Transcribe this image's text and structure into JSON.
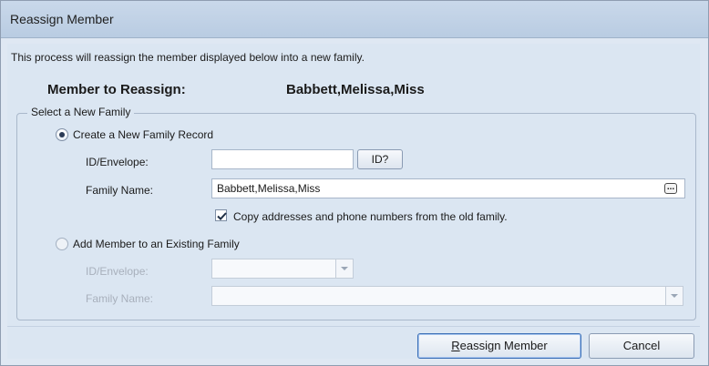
{
  "window": {
    "title": "Reassign Member"
  },
  "description": "This process will reassign the member displayed below into a new family.",
  "member": {
    "label": "Member to Reassign:",
    "value": "Babbett,Melissa,Miss"
  },
  "group": {
    "legend": "Select a New Family",
    "option_new": {
      "label": "Create a New Family Record",
      "selected": true,
      "id_label": "ID/Envelope:",
      "id_value": "",
      "id_button": "ID?",
      "family_label": "Family Name:",
      "family_value": "Babbett,Melissa,Miss",
      "ellipsis_button": "...",
      "copy_checkbox_label": "Copy addresses and phone numbers from the old family.",
      "copy_checked": true
    },
    "option_existing": {
      "label": "Add Member to an Existing Family",
      "selected": false,
      "id_label": "ID/Envelope:",
      "id_value": "",
      "family_label": "Family Name:",
      "family_value": ""
    }
  },
  "buttons": {
    "reassign": "Reassign Member",
    "cancel": "Cancel"
  }
}
